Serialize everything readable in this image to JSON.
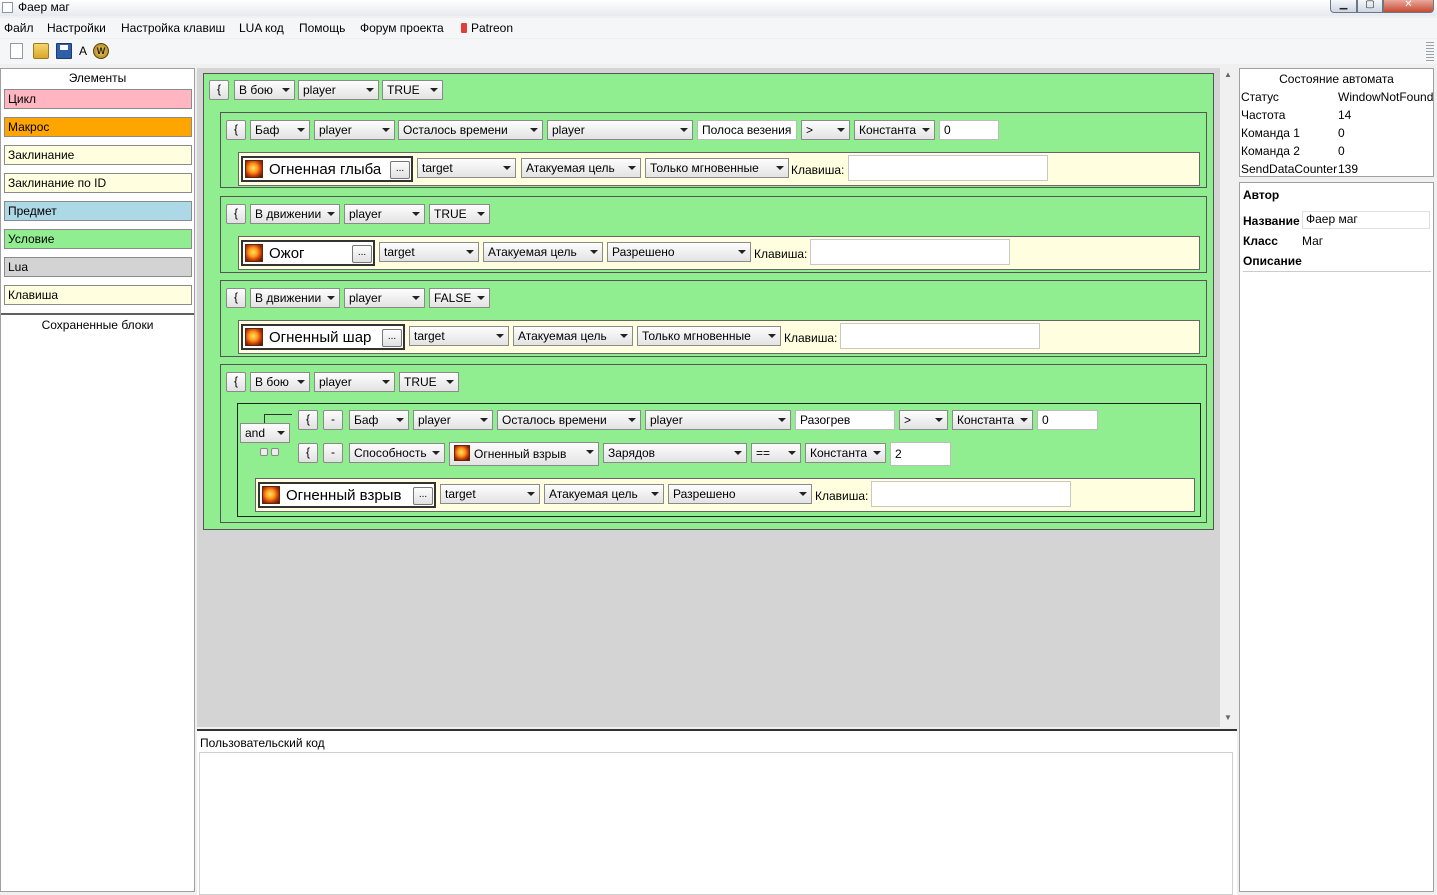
{
  "window": {
    "title": "Фаер маг",
    "min": "▁",
    "max": "▢",
    "close": "✕"
  },
  "menu": [
    "Файл",
    "Настройки",
    "Настройка клавиш",
    "LUA код",
    "Помощь",
    "Форум проекта",
    "Patreon"
  ],
  "toolbar": {
    "letter": "A",
    "wow": "W"
  },
  "elements": {
    "header": "Элементы",
    "items": [
      {
        "label": "Цикл",
        "color": "#ffb6c1"
      },
      {
        "label": "Макрос",
        "color": "#ffa500"
      },
      {
        "label": "Заклинание",
        "color": "#ffffe0"
      },
      {
        "label": "Заклинание по ID",
        "color": "#ffffe0"
      },
      {
        "label": "Предмет",
        "color": "#add8e6"
      },
      {
        "label": "Условие",
        "color": "#90ee90"
      },
      {
        "label": "Lua",
        "color": "#d3d3d3"
      },
      {
        "label": "Клавиша",
        "color": "#ffffe0"
      }
    ],
    "saved_header": "Сохраненные блоки"
  },
  "canvas": {
    "brace": "{",
    "minus": "-",
    "ellipsis": "...",
    "key_label": "Клавиша:",
    "outer": {
      "cond": "В бою",
      "unit": "player",
      "bool": "TRUE"
    },
    "b1": {
      "cond": {
        "type": "Баф",
        "unit": "player",
        "prop": "Осталось времени",
        "unit2": "player",
        "aura": "Полоса везения",
        "op": ">",
        "src": "Константа",
        "value": "0"
      },
      "spell": {
        "name": "Огненная глыба",
        "target": "target",
        "tmode": "Атакуемая цель",
        "cast": "Только мгновенные",
        "key": ""
      }
    },
    "b2": {
      "cond": {
        "cond": "В движении",
        "unit": "player",
        "bool": "TRUE"
      },
      "spell": {
        "name": "Ожог",
        "target": "target",
        "tmode": "Атакуемая цель",
        "cast": "Разрешено",
        "key": ""
      }
    },
    "b3": {
      "cond": {
        "cond": "В движении",
        "unit": "player",
        "bool": "FALSE"
      },
      "spell": {
        "name": "Огненный шар",
        "target": "target",
        "tmode": "Атакуемая цель",
        "cast": "Только мгновенные",
        "key": ""
      }
    },
    "b4": {
      "cond": {
        "cond": "В бою",
        "unit": "player",
        "bool": "TRUE"
      },
      "logic": "and",
      "c1": {
        "type": "Баф",
        "unit": "player",
        "prop": "Осталось времени",
        "unit2": "player",
        "aura": "Разогрев",
        "op": ">",
        "src": "Константа",
        "value": "0"
      },
      "c2": {
        "type": "Способность",
        "ability": "Огненный взрыв",
        "prop": "Зарядов",
        "op": "==",
        "src": "Константа",
        "value": "2"
      },
      "spell": {
        "name": "Огненный взрыв",
        "target": "target",
        "tmode": "Атакуемая цель",
        "cast": "Разрешено",
        "key": ""
      }
    }
  },
  "code": {
    "label": "Пользовательский код",
    "value": ""
  },
  "state": {
    "header": "Состояние автомата",
    "rows": [
      {
        "k": "Статус",
        "v": "WindowNotFound"
      },
      {
        "k": "Частота",
        "v": "14"
      },
      {
        "k": "Команда 1",
        "v": "0"
      },
      {
        "k": "Команда 2",
        "v": "0"
      },
      {
        "k": "SendDataCounter",
        "v": "139"
      }
    ]
  },
  "author": {
    "header": "Автор",
    "name_label": "Название",
    "name_value": "Фаер маг",
    "class_label": "Класс",
    "class_value": "Маг",
    "desc_label": "Описание"
  }
}
